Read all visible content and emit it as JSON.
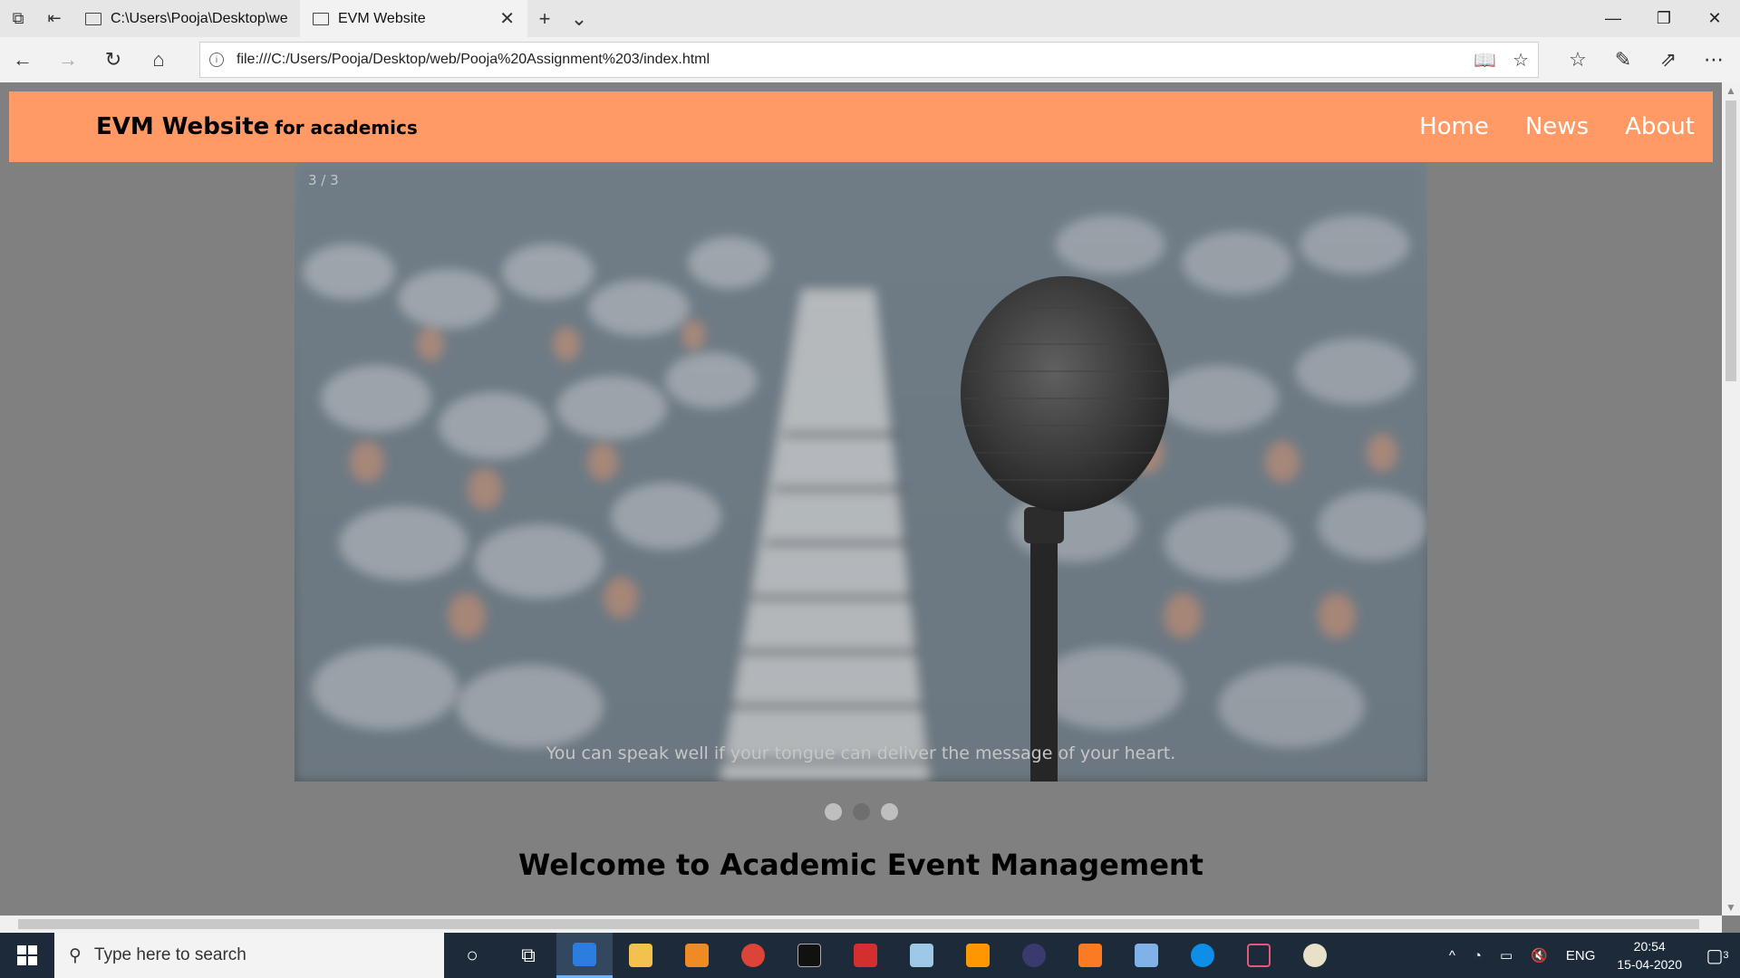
{
  "browser": {
    "tabs": [
      {
        "label": "C:\\Users\\Pooja\\Desktop\\we"
      },
      {
        "label": "EVM Website",
        "close": "✕"
      }
    ],
    "new_tab": "+",
    "tab_list": "⌄",
    "window_controls": {
      "minimize": "—",
      "restore": "❐",
      "close": "✕"
    },
    "url": "file:///C:/Users/Pooja/Desktop/web/Pooja%20Assignment%203/index.html",
    "info_glyph": "i"
  },
  "site": {
    "brand_main": "EVM Website",
    "brand_sub": "for academics",
    "nav": [
      "Home",
      "News",
      "About"
    ],
    "header_color": "#ff9966",
    "slideshow": {
      "counter": "3 / 3",
      "caption": "You can speak well if your tongue can deliver the message of your heart.",
      "total": 3,
      "current": 3
    },
    "welcome": "Welcome to Academic Event Management"
  },
  "taskbar": {
    "search_placeholder": "Type here to search",
    "tray_lang": "ENG",
    "time": "20:54",
    "date": "15-04-2020",
    "notifications": "3"
  }
}
